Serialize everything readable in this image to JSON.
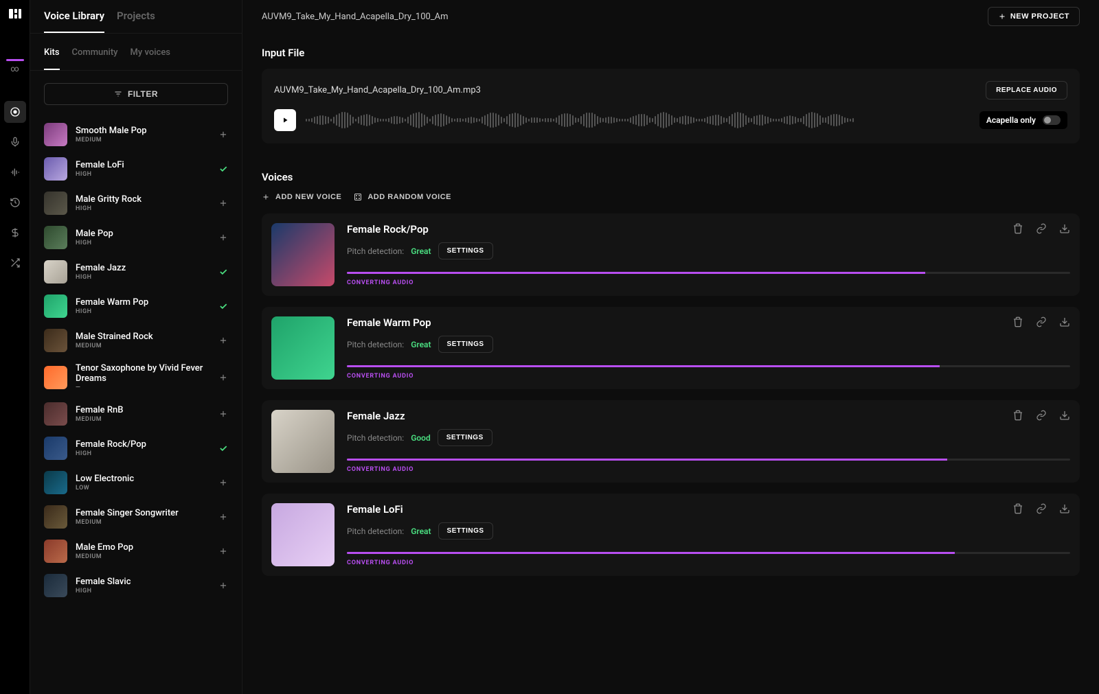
{
  "header": {
    "project_name": "AUVM9_Take_My_Hand_Acapella_Dry_100_Am",
    "new_project_label": "NEW PROJECT"
  },
  "top_tabs": {
    "voice_library": "Voice Library",
    "projects": "Projects"
  },
  "sub_tabs": {
    "kits": "Kits",
    "community": "Community",
    "my_voices": "My voices"
  },
  "filter_label": "FILTER",
  "library": [
    {
      "name": "Smooth Male Pop",
      "level": "MEDIUM",
      "selected": false,
      "c1": "#7b3b7c",
      "c2": "#c77ac2"
    },
    {
      "name": "Female LoFi",
      "level": "HIGH",
      "selected": true,
      "c1": "#6b5cae",
      "c2": "#b9a8e0"
    },
    {
      "name": "Male Gritty Rock",
      "level": "HIGH",
      "selected": false,
      "c1": "#35332c",
      "c2": "#5b584a"
    },
    {
      "name": "Male Pop",
      "level": "HIGH",
      "selected": false,
      "c1": "#2e4a2e",
      "c2": "#5b7d5b"
    },
    {
      "name": "Female Jazz",
      "level": "HIGH",
      "selected": true,
      "c1": "#d8d3c8",
      "c2": "#a8a296"
    },
    {
      "name": "Female Warm Pop",
      "level": "HIGH",
      "selected": true,
      "c1": "#1fa36a",
      "c2": "#3fd48f"
    },
    {
      "name": "Male Strained Rock",
      "level": "MEDIUM",
      "selected": false,
      "c1": "#3b2b1a",
      "c2": "#6b533a"
    },
    {
      "name": "Tenor Saxophone by Vivid Fever Dreams",
      "level": "—",
      "selected": false,
      "c1": "#ff6a2b",
      "c2": "#ff9a5b"
    },
    {
      "name": "Female RnB",
      "level": "MEDIUM",
      "selected": false,
      "c1": "#4a2c2c",
      "c2": "#7a4c4c"
    },
    {
      "name": "Female Rock/Pop",
      "level": "HIGH",
      "selected": true,
      "c1": "#1a3a6a",
      "c2": "#3a5a8a"
    },
    {
      "name": "Low Electronic",
      "level": "LOW",
      "selected": false,
      "c1": "#0a3a4a",
      "c2": "#1a6a8a"
    },
    {
      "name": "Female Singer Songwriter",
      "level": "MEDIUM",
      "selected": false,
      "c1": "#3a2a1a",
      "c2": "#6a5a3a"
    },
    {
      "name": "Male Emo Pop",
      "level": "MEDIUM",
      "selected": false,
      "c1": "#8a3a2a",
      "c2": "#ba6a4a"
    },
    {
      "name": "Female Slavic",
      "level": "HIGH",
      "selected": false,
      "c1": "#1a2a3a",
      "c2": "#3a4a5a"
    }
  ],
  "input_section": {
    "title": "Input File",
    "filename": "AUVM9_Take_My_Hand_Acapella_Dry_100_Am.mp3",
    "replace_label": "REPLACE AUDIO",
    "acapella_label": "Acapella only"
  },
  "voices_section": {
    "title": "Voices",
    "add_voice_label": "ADD NEW VOICE",
    "add_random_label": "ADD RANDOM VOICE"
  },
  "cards": [
    {
      "name": "Female Rock/Pop",
      "pitch_label": "Pitch detection:",
      "pitch_value": "Great",
      "pitch_class": "great",
      "settings": "SETTINGS",
      "progress": 80,
      "status": "CONVERTING AUDIO",
      "c1": "#1a3a6a",
      "c2": "#c74a6a"
    },
    {
      "name": "Female Warm Pop",
      "pitch_label": "Pitch detection:",
      "pitch_value": "Great",
      "pitch_class": "great",
      "settings": "SETTINGS",
      "progress": 82,
      "status": "CONVERTING AUDIO",
      "c1": "#1fa36a",
      "c2": "#3fd48f"
    },
    {
      "name": "Female Jazz",
      "pitch_label": "Pitch detection:",
      "pitch_value": "Good",
      "pitch_class": "good",
      "settings": "SETTINGS",
      "progress": 83,
      "status": "CONVERTING AUDIO",
      "c1": "#d8d3c8",
      "c2": "#9a9488"
    },
    {
      "name": "Female LoFi",
      "pitch_label": "Pitch detection:",
      "pitch_value": "Great",
      "pitch_class": "great",
      "settings": "SETTINGS",
      "progress": 84,
      "status": "CONVERTING AUDIO",
      "c1": "#c7a8e0",
      "c2": "#e8d0f5"
    }
  ]
}
